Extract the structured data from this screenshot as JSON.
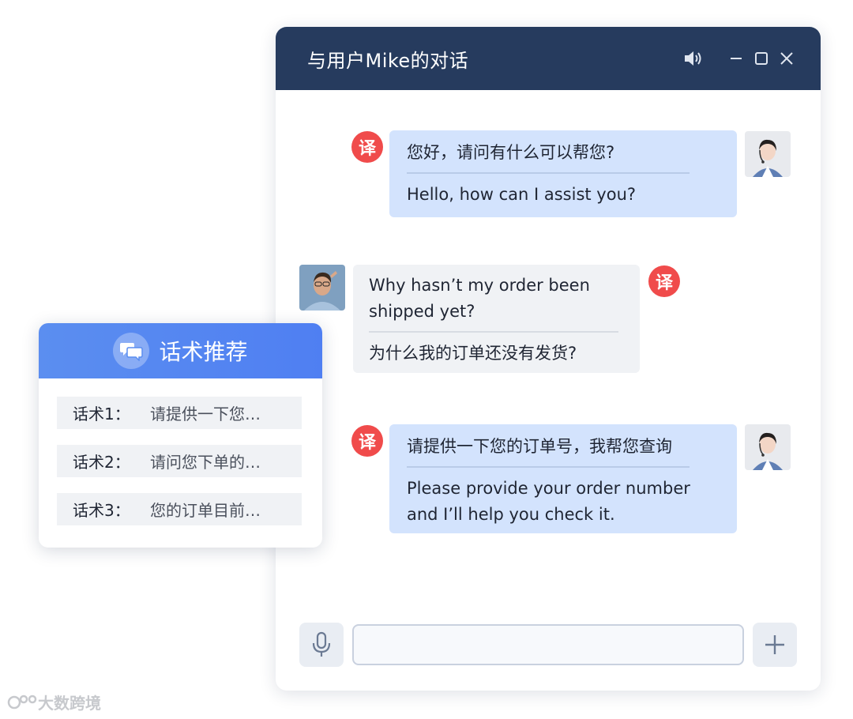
{
  "chat": {
    "title": "与用户Mike的对话",
    "messages": [
      {
        "role": "agent",
        "original": "您好，请问有什么可以帮您?",
        "translation": "Hello, how can I assist you?"
      },
      {
        "role": "customer",
        "original": "Why hasn’t my order been shipped yet?",
        "translation": "为什么我的订单还没有发货?"
      },
      {
        "role": "agent",
        "original": "请提供一下您的订单号，我帮您查询",
        "translation": "Please provide your order number and I’ll help you check it."
      }
    ],
    "translate_badge": "译",
    "input": {
      "value": "",
      "placeholder": ""
    },
    "icons": {
      "speaker": "speaker-icon",
      "minimize": "minimize-icon",
      "maximize": "maximize-icon",
      "close": "close-icon",
      "mic": "microphone-icon",
      "add": "plus-icon"
    }
  },
  "script_panel": {
    "title": "话术推荐",
    "icon": "chat-bubbles-icon",
    "items": [
      {
        "label": "话术1：",
        "text": "请提供一下您…"
      },
      {
        "label": "话术2：",
        "text": "请问您下单的…"
      },
      {
        "label": "话术3：",
        "text": "您的订单目前…"
      }
    ]
  },
  "watermark": {
    "text": "大数跨境"
  },
  "colors": {
    "titlebar": "#263b5e",
    "agent_bubble": "#d3e3fd",
    "customer_bubble": "#f0f2f5",
    "badge": "#f04b4b",
    "panel_header": "#5b8ef0"
  }
}
